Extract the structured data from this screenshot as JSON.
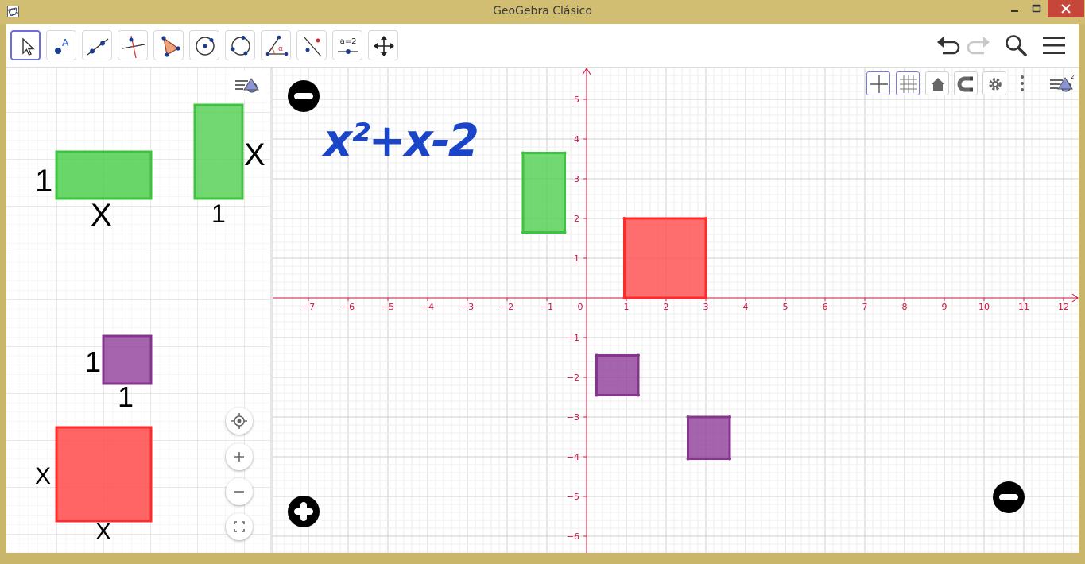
{
  "window": {
    "title": "GeoGebra Clásico"
  },
  "toolbar": {
    "tools": [
      {
        "name": "move",
        "selected": true
      },
      {
        "name": "point",
        "label": "A"
      },
      {
        "name": "line"
      },
      {
        "name": "perpendicular-line"
      },
      {
        "name": "polygon"
      },
      {
        "name": "circle-center-point"
      },
      {
        "name": "circle-three-points"
      },
      {
        "name": "angle",
        "label": "α"
      },
      {
        "name": "reflect"
      },
      {
        "name": "slider",
        "label": "a=2"
      },
      {
        "name": "move-graphics-view"
      }
    ],
    "right": [
      "undo-icon",
      "redo-icon",
      "search-icon",
      "menu-icon"
    ]
  },
  "left_view": {
    "labels": {
      "green_h_left": "1",
      "green_h_bottom": "X",
      "green_v_right": "X",
      "green_v_bottom": "1",
      "purple_left": "1",
      "purple_bottom": "1",
      "red_left": "X",
      "red_bottom": "X"
    }
  },
  "graphics": {
    "formula": "x²+x-2",
    "x_ticks": [
      "−7",
      "−6",
      "−5",
      "−4",
      "−3",
      "−2",
      "−1",
      "0",
      "1",
      "2",
      "3",
      "4",
      "5",
      "6",
      "7",
      "8",
      "9",
      "10",
      "11",
      "12"
    ],
    "y_ticks": [
      "5",
      "4",
      "3",
      "2",
      "1",
      "−1",
      "−2",
      "−3",
      "−4",
      "−5",
      "−6"
    ]
  },
  "colors": {
    "green": "#4fcf4f",
    "red": "#ff4a4a",
    "purple": "#8f3d98",
    "formula": "#1b45c8",
    "axis": "#d1113f"
  }
}
